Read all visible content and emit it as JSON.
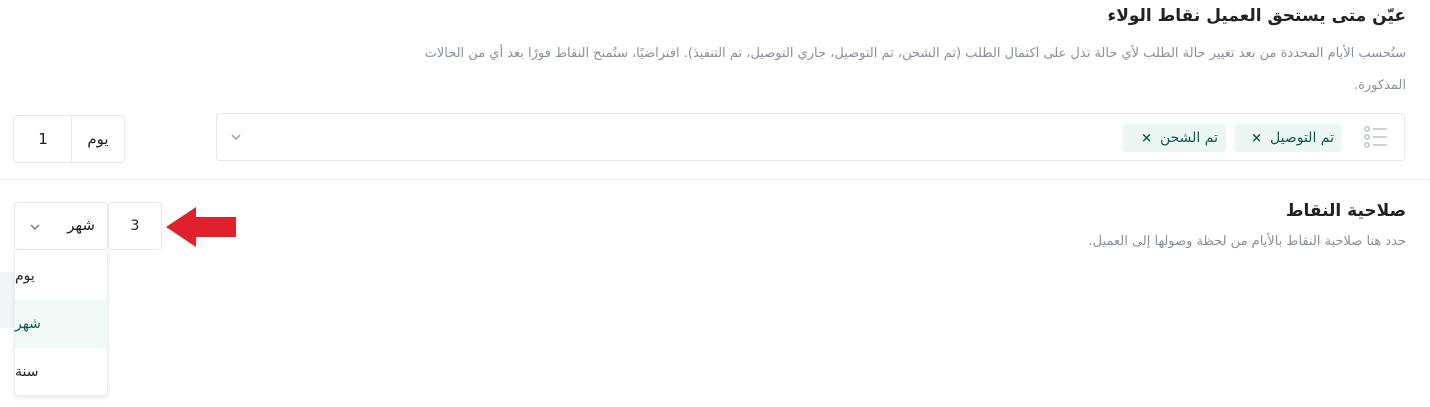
{
  "award": {
    "title": "عيّن متى يستحق العميل نقاط الولاء",
    "description": "ستُحسب الأيام المحددة من بعد تغيير حالة الطلب لأي حالة تدل على اكتمال الطلب (تم الشحن، تم التوصيل، جاري التوصيل، تم التنفيذ). افتراضيًا، ستُمنح النقاط فورًا بعد أي من الحالات المذكورة.",
    "chips": [
      "تم التوصيل",
      "تم الشحن"
    ],
    "chip_remove": "×",
    "duration_value": "1",
    "duration_unit": "يوم"
  },
  "validity": {
    "title": "صلاحية النقاط",
    "description": "حدد هنا صلاحية النقاط بالأيام من لحظة وصولها إلى العميل.",
    "value": "3",
    "selected_unit": "شهر",
    "options": [
      "يوم",
      "شهر",
      "سنة"
    ]
  },
  "colors": {
    "chip_bg": "#ecf7f3",
    "chip_text": "#12584a",
    "annotation_arrow": "#e0202a"
  }
}
